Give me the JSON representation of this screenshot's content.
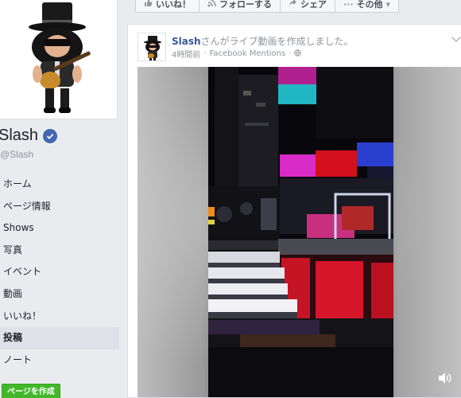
{
  "page": {
    "name": "Slash",
    "handle": "@Slash"
  },
  "nav": {
    "items": [
      {
        "label": "ホーム",
        "active": false
      },
      {
        "label": "ページ情報",
        "active": false
      },
      {
        "label": "Shows",
        "active": false
      },
      {
        "label": "写真",
        "active": false
      },
      {
        "label": "イベント",
        "active": false
      },
      {
        "label": "動画",
        "active": false
      },
      {
        "label": "いいね！",
        "active": false
      },
      {
        "label": "投稿",
        "active": true
      },
      {
        "label": "ノート",
        "active": false
      }
    ],
    "create_page_label": "ページを作成"
  },
  "action_bar": {
    "like_label": "いいね！",
    "follow_label": "フォローする",
    "share_label": "シェア",
    "more_label": "その他"
  },
  "post": {
    "author": "Slash",
    "action_text": "さんがライブ動画を作成しました。",
    "time": "4時間前",
    "separator": "·",
    "source": "Facebook Mentions",
    "privacy_icon": "globe-icon"
  },
  "video": {
    "volume_icon": "volume-icon"
  },
  "colors": {
    "link": "#365899",
    "create_button": "#42b72a",
    "verified": "#4267b2",
    "active_nav": "#dfe1e6"
  }
}
